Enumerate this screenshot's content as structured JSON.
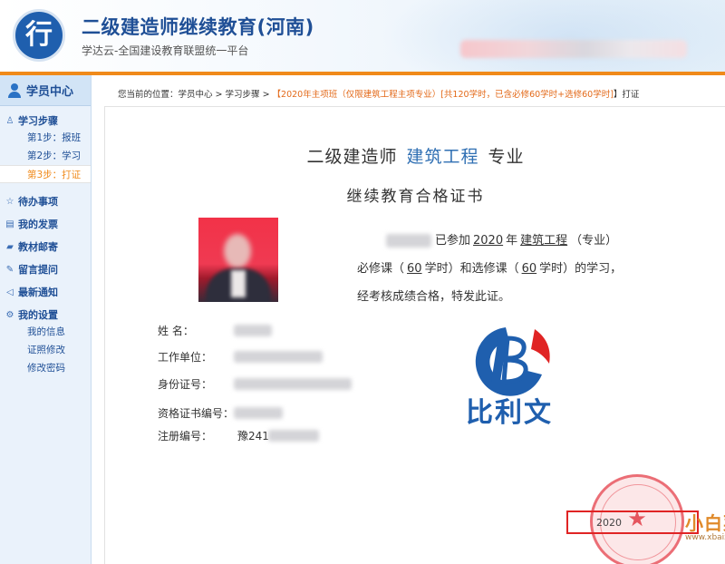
{
  "header": {
    "logo_glyph": "行",
    "title": "二级建造师继续教育(河南)",
    "subtitle": "学达云-全国建设教育联盟统一平台"
  },
  "sidebar": {
    "heading": "学员中心",
    "sections": [
      {
        "label": "学习步骤",
        "icon": "person-outline-icon",
        "items": [
          {
            "label": "第1步：报班",
            "active": false
          },
          {
            "label": "第2步：学习",
            "active": false
          },
          {
            "label": "第3步：打证",
            "active": true
          }
        ]
      },
      {
        "label": "待办事项",
        "icon": "pin-icon",
        "items": []
      },
      {
        "label": "我的发票",
        "icon": "invoice-icon",
        "items": []
      },
      {
        "label": "教材邮寄",
        "icon": "truck-icon",
        "items": []
      },
      {
        "label": "留言提问",
        "icon": "pencil-icon",
        "items": []
      },
      {
        "label": "最新通知",
        "icon": "megaphone-icon",
        "items": []
      },
      {
        "label": "我的设置",
        "icon": "gear-icon",
        "items": [
          {
            "label": "我的信息",
            "active": false
          },
          {
            "label": "证照修改",
            "active": false
          },
          {
            "label": "修改密码",
            "active": false
          }
        ]
      }
    ]
  },
  "breadcrumb": {
    "prefix": "您当前的位置：",
    "home": "学员中心",
    "sep": " > ",
    "step": "学习步骤",
    "course": "【2020年主项班（仅限建筑工程主项专业）[共120学时，已含必修60学时+选修60学时]",
    "action": "】打证"
  },
  "certificate": {
    "title_prefix": "二级建造师",
    "major": "建筑工程",
    "title_suffix": "专业",
    "subtitle": "继续教育合格证书",
    "body1_a": "已参加",
    "year": "2020",
    "body1_b": "年",
    "major_u": "建筑工程",
    "body1_c": "（专业）",
    "body2_a": "必修课（",
    "required_hours": "60",
    "body2_b": "学时）和选修课（",
    "elective_hours": "60",
    "body2_c": "学时）的学习，",
    "body3": "经考核成绩合格，特发此证。",
    "fields": {
      "name_label": "姓  名：",
      "employer_label": "工作单位：",
      "id_label": "身份证号：",
      "cert_no_label": "资格证书编号：",
      "reg_no_label": "注册编号：",
      "reg_no_prefix": "豫241"
    },
    "logo_text": "比利文",
    "stamp_year": "2020"
  },
  "watermark": {
    "brand": "小白菜",
    "url": "www.xbaixing.com"
  },
  "colors": {
    "brand_blue": "#1f4f96",
    "accent_orange": "#f08a1a",
    "highlight_red": "#e02424"
  }
}
